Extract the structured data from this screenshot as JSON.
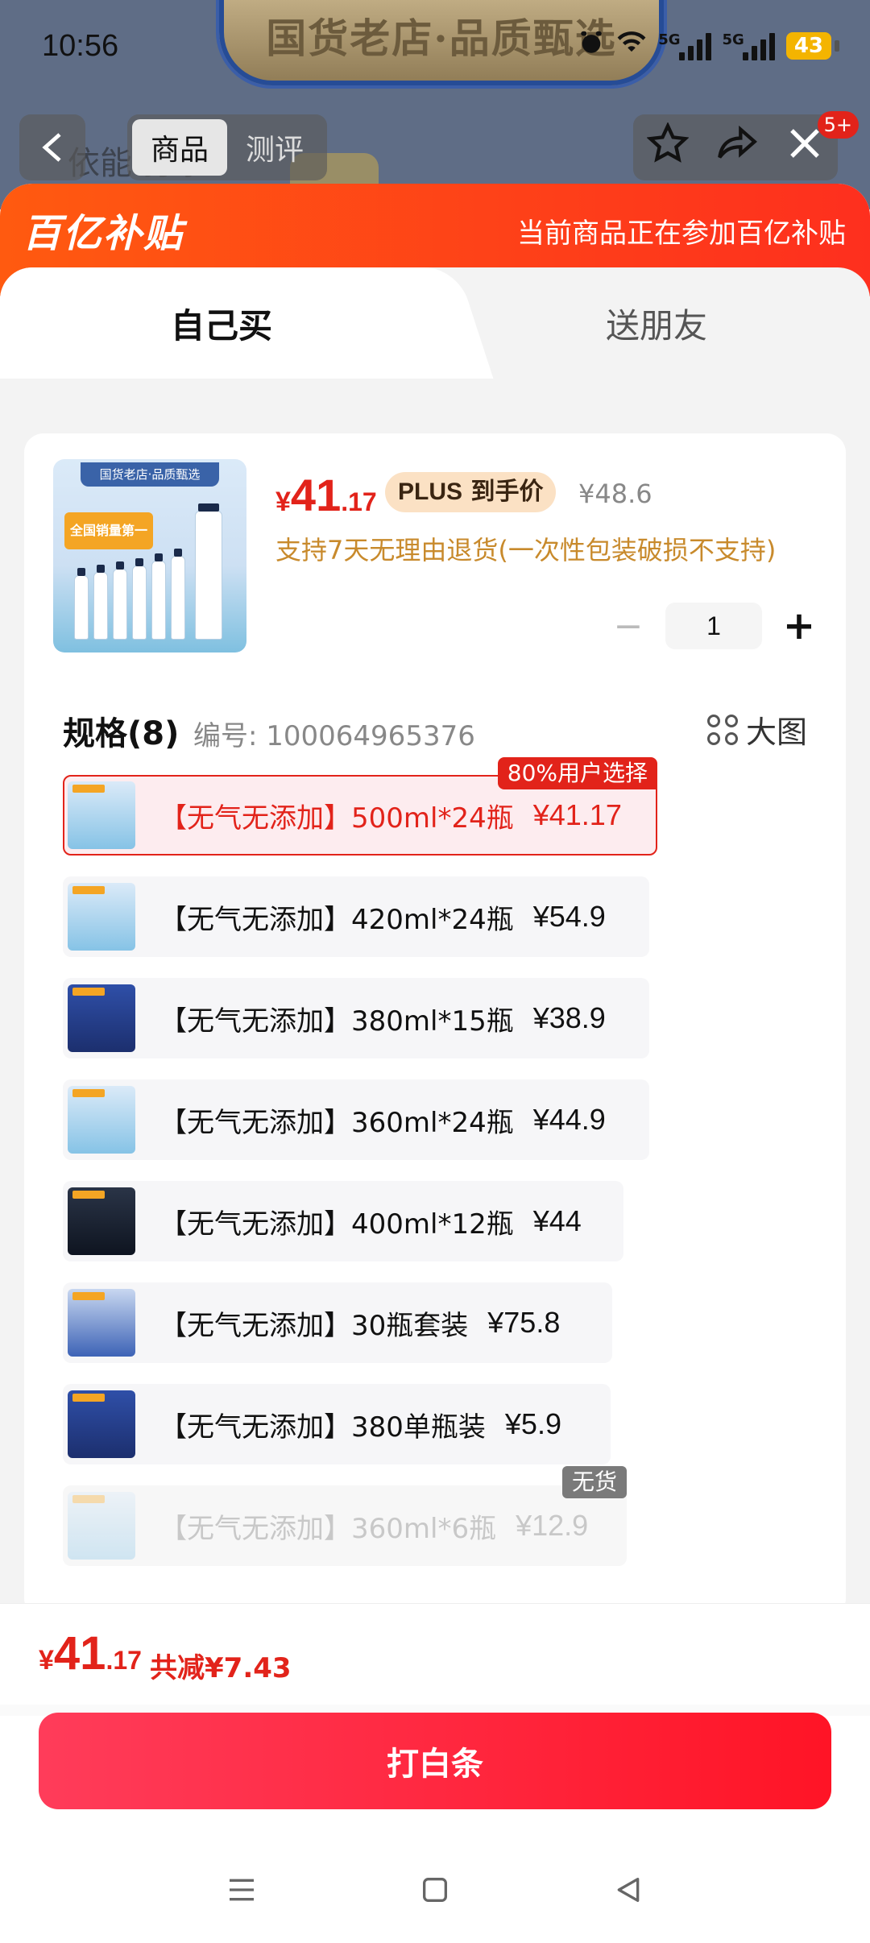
{
  "background": {
    "banner_text": "国货老店·品质甄选",
    "product_title_partial": "依能 打水"
  },
  "status_bar": {
    "time": "10:56",
    "network1": "5G",
    "network2": "5G",
    "battery": "43"
  },
  "top_nav": {
    "tabs": [
      "商品",
      "测评"
    ],
    "active_tab": "商品",
    "badge": "5+"
  },
  "promo": {
    "logo": "百亿补贴",
    "text": "当前商品正在参加百亿补贴"
  },
  "mode_tabs": {
    "self": "自己买",
    "gift": "送朋友"
  },
  "product": {
    "thumb_header": "国货老店·品质甄选",
    "thumb_badge": "全国销量第一",
    "price_yen": "¥",
    "price_int": "41",
    "price_dec": ".17",
    "plus_label": "PLUS",
    "plus_suffix": "到手价",
    "original_price": "¥48.6",
    "return_note": "支持7天无理由退货(一次性包装破损不支持)",
    "quantity": "1"
  },
  "spec_section": {
    "title": "规格(8)",
    "code": "编号: 100064965376",
    "big_view": "大图",
    "items": [
      {
        "name": "【无气无添加】500ml*24瓶",
        "price": "¥41.17",
        "tag": "80%用户选择",
        "state": "selected"
      },
      {
        "name": "【无气无添加】420ml*24瓶",
        "price": "¥54.9",
        "tag": "",
        "state": "normal"
      },
      {
        "name": "【无气无添加】380ml*15瓶",
        "price": "¥38.9",
        "tag": "",
        "state": "normal"
      },
      {
        "name": "【无气无添加】360ml*24瓶",
        "price": "¥44.9",
        "tag": "",
        "state": "normal"
      },
      {
        "name": "【无气无添加】400ml*12瓶",
        "price": "¥44",
        "tag": "",
        "state": "normal"
      },
      {
        "name": "【无气无添加】30瓶套装",
        "price": "¥75.8",
        "tag": "",
        "state": "normal"
      },
      {
        "name": "【无气无添加】380单瓶装",
        "price": "¥5.9",
        "tag": "",
        "state": "normal"
      },
      {
        "name": "【无气无添加】360ml*6瓶",
        "price": "¥12.9",
        "tag": "无货",
        "state": "out_of_stock"
      }
    ]
  },
  "footer": {
    "yen": "¥",
    "total_int": "41",
    "total_dec": ".17",
    "saved": "共减¥7.43",
    "cta": "打白条"
  },
  "colors": {
    "accent_red": "#e2231a",
    "promo_orange": "#ff5a10",
    "cta_red": "#ff1426",
    "note_gold": "#c88a2c"
  }
}
